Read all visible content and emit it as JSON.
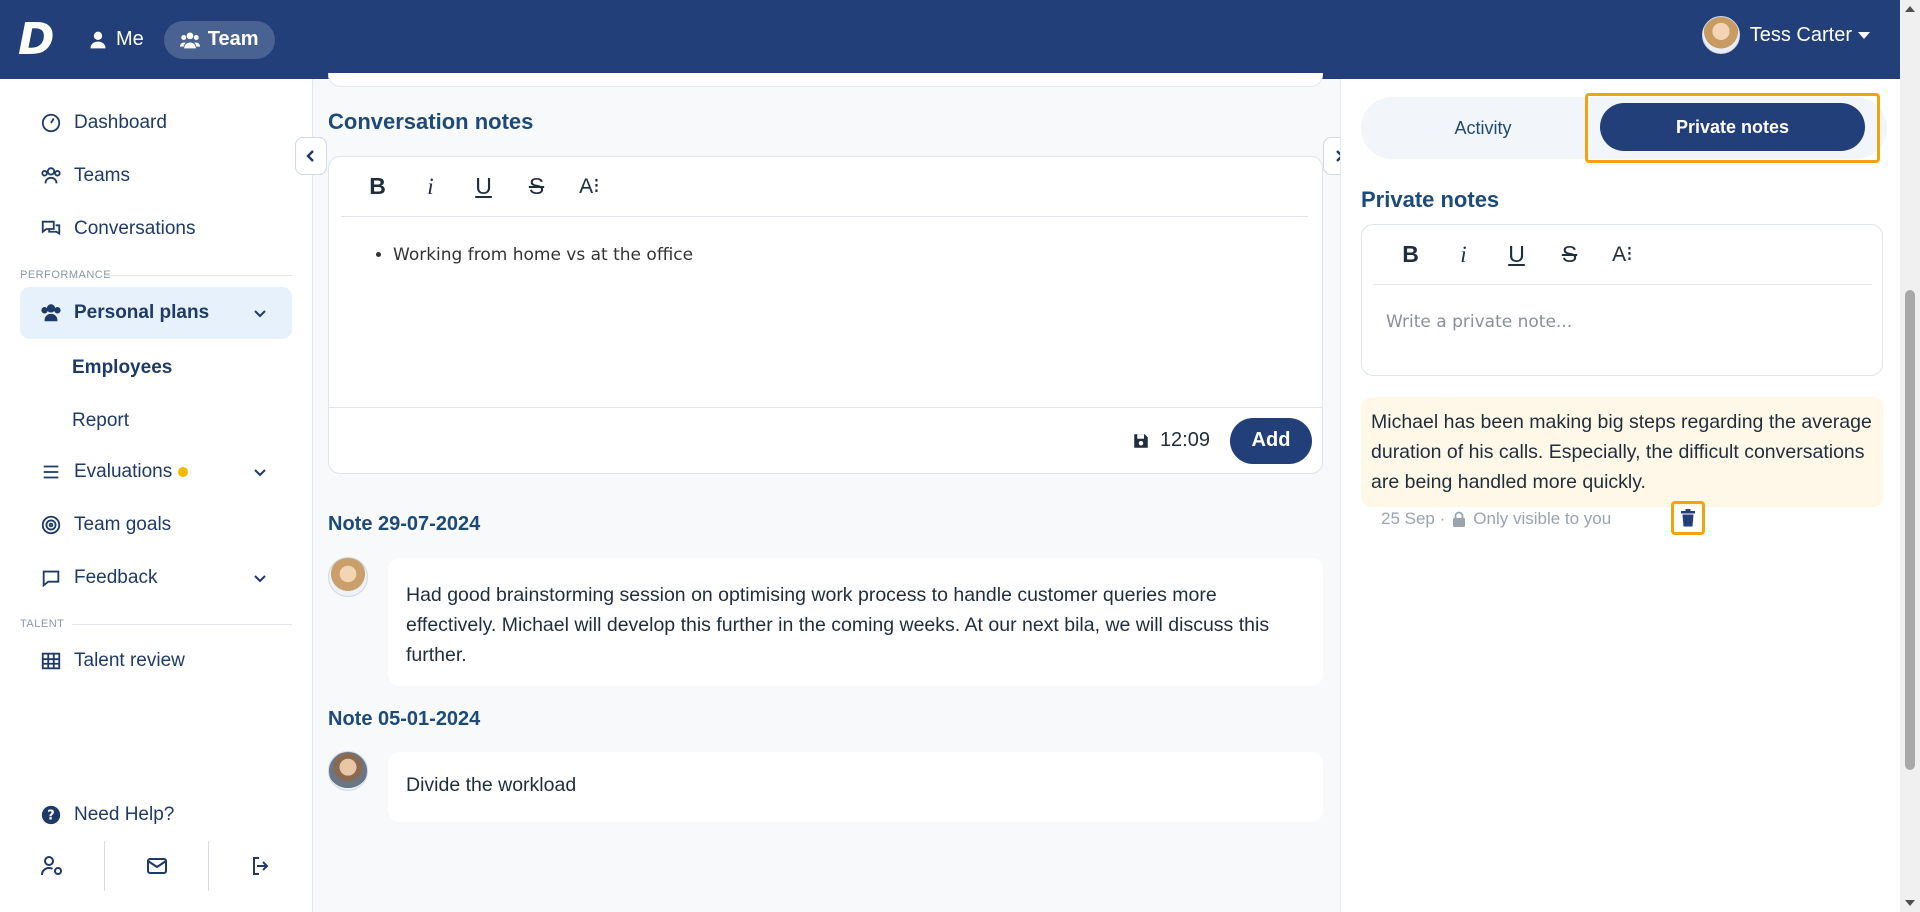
{
  "topbar": {
    "nav": [
      {
        "label": "Me",
        "icon": "user-icon"
      },
      {
        "label": "Team",
        "icon": "team-icon",
        "active": true
      }
    ],
    "user_name": "Tess Carter",
    "logo_letter": "D"
  },
  "sidebar": {
    "items": [
      {
        "label": "Dashboard"
      },
      {
        "label": "Teams"
      },
      {
        "label": "Conversations"
      }
    ],
    "section_performance": "PERFORMANCE",
    "personal_plans": "Personal plans",
    "sub_items": [
      "Employees",
      "Report"
    ],
    "evaluations": "Evaluations",
    "team_goals": "Team goals",
    "feedback": "Feedback",
    "section_talent": "TALENT",
    "talent_review": "Talent review",
    "need_help": "Need Help?"
  },
  "main": {
    "conversation_notes_title": "Conversation notes",
    "toolbar": {
      "bold": "B",
      "italic": "i",
      "underline": "U",
      "strike": "S",
      "size": "A⁝"
    },
    "editor_bullet": "Working from home vs at the office",
    "saved_time": "12:09",
    "add_label": "Add",
    "notes": [
      {
        "date": "Note 29-07-2024",
        "text": "Had good brainstorming session on optimising work process to handle customer queries more effectively. Michael will develop this further in the coming weeks. At our next bila, we will discuss this further."
      },
      {
        "date": "Note 05-01-2024",
        "text": "Divide the workload"
      }
    ]
  },
  "right_panel": {
    "tabs": {
      "activity": "Activity",
      "private": "Private notes"
    },
    "title": "Private notes",
    "placeholder": "Write a private note...",
    "note_text": "Michael has been making big steps regarding the average duration of his calls. Especially, the difficult conversations are being handled more quickly.",
    "note_date": "25 Sep ·",
    "visibility": "Only visible to you"
  },
  "colors": {
    "brand": "#233f7a",
    "highlight": "#f2a30f",
    "note_bg": "#fff8e8"
  }
}
